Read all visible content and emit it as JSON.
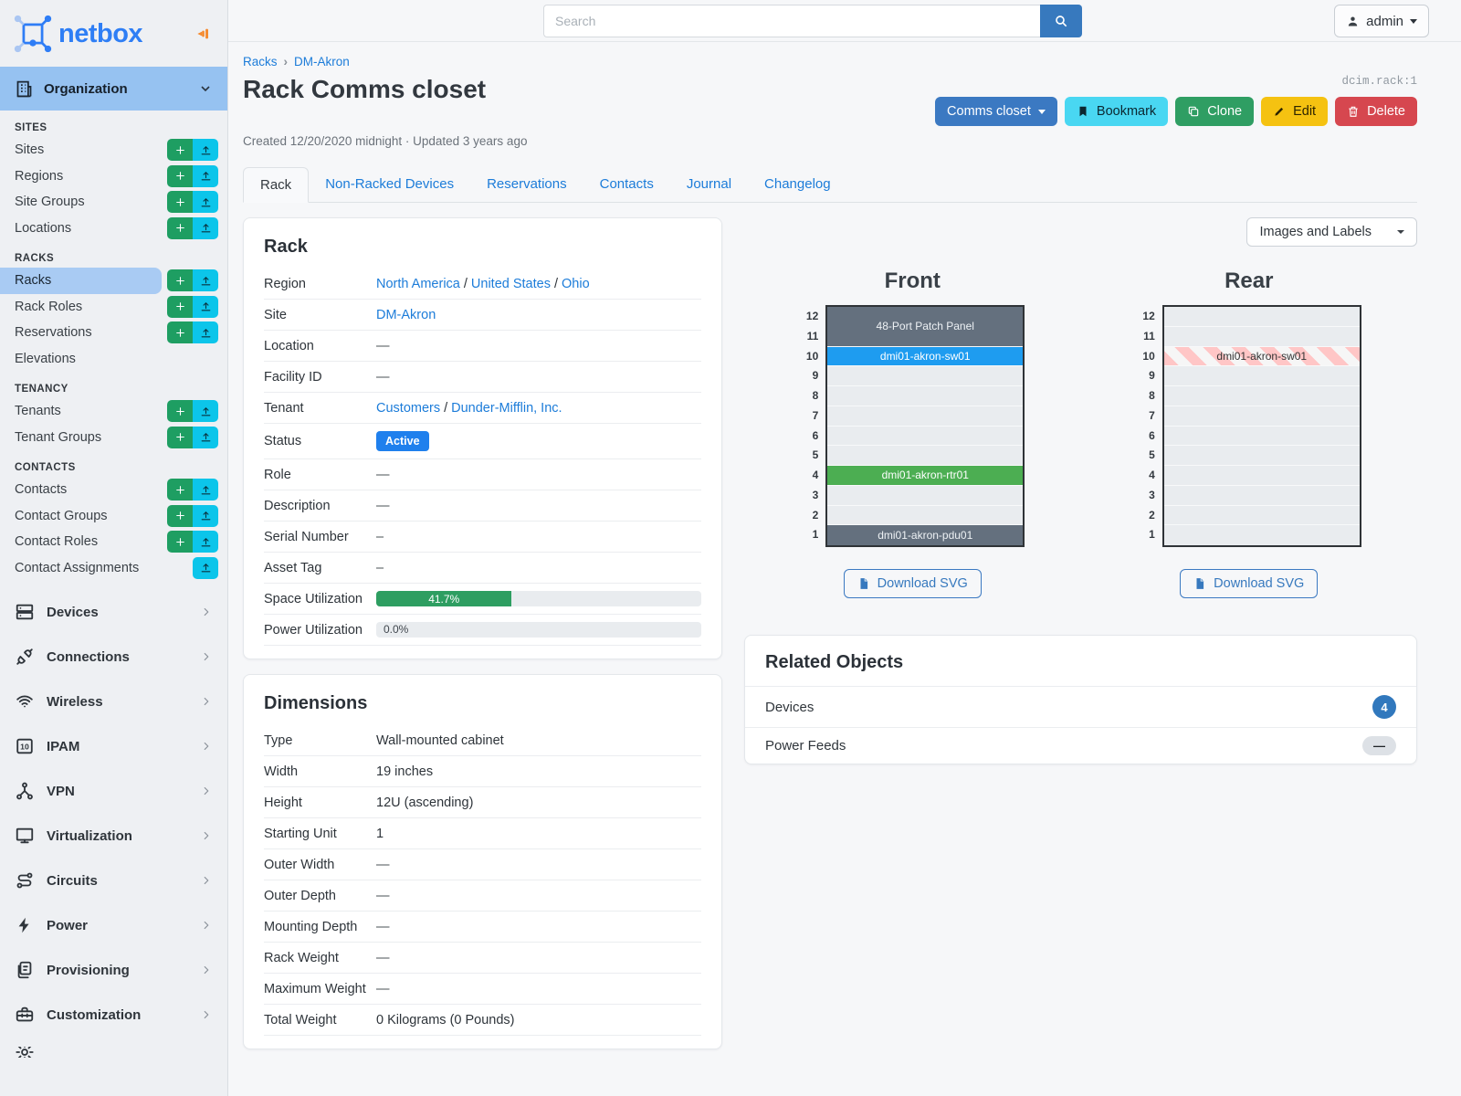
{
  "sidebar": {
    "logo_text": "netbox",
    "org_label": "Organization",
    "sections": [
      {
        "header": "SITES",
        "items": [
          {
            "label": "Sites",
            "add": true,
            "import": true
          },
          {
            "label": "Regions",
            "add": true,
            "import": true
          },
          {
            "label": "Site Groups",
            "add": true,
            "import": true
          },
          {
            "label": "Locations",
            "add": true,
            "import": true
          }
        ]
      },
      {
        "header": "RACKS",
        "items": [
          {
            "label": "Racks",
            "add": true,
            "import": true,
            "active": true
          },
          {
            "label": "Rack Roles",
            "add": true,
            "import": true
          },
          {
            "label": "Reservations",
            "add": true,
            "import": true
          },
          {
            "label": "Elevations"
          }
        ]
      },
      {
        "header": "TENANCY",
        "items": [
          {
            "label": "Tenants",
            "add": true,
            "import": true
          },
          {
            "label": "Tenant Groups",
            "add": true,
            "import": true
          }
        ]
      },
      {
        "header": "CONTACTS",
        "items": [
          {
            "label": "Contacts",
            "add": true,
            "import": true
          },
          {
            "label": "Contact Groups",
            "add": true,
            "import": true
          },
          {
            "label": "Contact Roles",
            "add": true,
            "import": true
          },
          {
            "label": "Contact Assignments",
            "import": true
          }
        ]
      }
    ],
    "menus": [
      {
        "label": "Devices",
        "icon": "server"
      },
      {
        "label": "Connections",
        "icon": "plug"
      },
      {
        "label": "Wireless",
        "icon": "wifi"
      },
      {
        "label": "IPAM",
        "icon": "binary"
      },
      {
        "label": "VPN",
        "icon": "network"
      },
      {
        "label": "Virtualization",
        "icon": "monitor"
      },
      {
        "label": "Circuits",
        "icon": "route"
      },
      {
        "label": "Power",
        "icon": "bolt"
      },
      {
        "label": "Provisioning",
        "icon": "files"
      },
      {
        "label": "Customization",
        "icon": "toolbox"
      },
      {
        "label": "",
        "icon": "gear",
        "partial": true
      }
    ]
  },
  "header": {
    "search_placeholder": "Search",
    "user": "admin"
  },
  "page": {
    "breadcrumb": [
      "Racks",
      "DM-Akron"
    ],
    "title": "Rack Comms closet",
    "meta": "Created 12/20/2020 midnight · Updated 3 years ago",
    "object_id": "dcim.rack:1",
    "actions": {
      "context": "Comms closet",
      "bookmark": "Bookmark",
      "clone": "Clone",
      "edit": "Edit",
      "delete": "Delete"
    },
    "tabs": [
      {
        "label": "Rack",
        "active": true
      },
      {
        "label": "Non-Racked Devices"
      },
      {
        "label": "Reservations"
      },
      {
        "label": "Contacts"
      },
      {
        "label": "Journal"
      },
      {
        "label": "Changelog"
      }
    ]
  },
  "rack_panel": {
    "title": "Rack",
    "rows": [
      {
        "label": "Region",
        "type": "links",
        "parts": [
          "North America",
          "United States",
          "Ohio"
        ]
      },
      {
        "label": "Site",
        "type": "links",
        "parts": [
          "DM-Akron"
        ]
      },
      {
        "label": "Location",
        "type": "dash",
        "value": "—"
      },
      {
        "label": "Facility ID",
        "type": "dash",
        "value": "—"
      },
      {
        "label": "Tenant",
        "type": "links",
        "parts": [
          "Customers",
          "Dunder-Mifflin, Inc."
        ]
      },
      {
        "label": "Status",
        "type": "badge",
        "value": "Active"
      },
      {
        "label": "Role",
        "type": "dash",
        "value": "—"
      },
      {
        "label": "Description",
        "type": "dash",
        "value": "—"
      },
      {
        "label": "Serial Number",
        "type": "dash",
        "value": "–"
      },
      {
        "label": "Asset Tag",
        "type": "dash",
        "value": "–"
      },
      {
        "label": "Space Utilization",
        "type": "progress",
        "percent": 41.7,
        "text": "41.7%"
      },
      {
        "label": "Power Utilization",
        "type": "progress",
        "percent": 0,
        "text": "0.0%"
      }
    ]
  },
  "dimensions_panel": {
    "title": "Dimensions",
    "rows": [
      {
        "label": "Type",
        "value": "Wall-mounted cabinet"
      },
      {
        "label": "Width",
        "value": "19 inches"
      },
      {
        "label": "Height",
        "value": "12U (ascending)"
      },
      {
        "label": "Starting Unit",
        "value": "1"
      },
      {
        "label": "Outer Width",
        "value": "—"
      },
      {
        "label": "Outer Depth",
        "value": "—"
      },
      {
        "label": "Mounting Depth",
        "value": "—"
      },
      {
        "label": "Rack Weight",
        "value": "—"
      },
      {
        "label": "Maximum Weight",
        "value": "—"
      },
      {
        "label": "Total Weight",
        "value": "0 Kilograms (0 Pounds)"
      }
    ]
  },
  "elevations": {
    "view_mode": "Images and Labels",
    "units": 12,
    "front": {
      "title": "Front",
      "download_label": "Download SVG",
      "devices": [
        {
          "name": "48-Port Patch Panel",
          "top_unit": 12,
          "span": 2,
          "color": "slate"
        },
        {
          "name": "dmi01-akron-sw01",
          "top_unit": 10,
          "span": 1,
          "color": "blue"
        },
        {
          "name": "dmi01-akron-rtr01",
          "top_unit": 4,
          "span": 1,
          "color": "green"
        },
        {
          "name": "dmi01-akron-pdu01",
          "top_unit": 1,
          "span": 1,
          "color": "slate"
        }
      ]
    },
    "rear": {
      "title": "Rear",
      "download_label": "Download SVG",
      "devices": [
        {
          "name": "dmi01-akron-sw01",
          "top_unit": 10,
          "span": 1,
          "color": "striped"
        }
      ]
    }
  },
  "related": {
    "title": "Related Objects",
    "rows": [
      {
        "label": "Devices",
        "badge": "4",
        "badge_style": "blue"
      },
      {
        "label": "Power Feeds",
        "badge": "—",
        "badge_style": "gray"
      }
    ]
  },
  "colors": {
    "brand_blue": "#2e7ef5",
    "link_blue": "#1c7cd9",
    "add_green": "#1e9e62",
    "import_cyan": "#0cc5ea",
    "primary_button": "#3b79c2",
    "bookmark_cyan": "#49d7f2",
    "clone_green": "#2f9e63",
    "edit_yellow": "#f5c211",
    "delete_red": "#d6474f",
    "status_active": "#1f80ed",
    "utilization_green": "#2e9e61",
    "device_slate": "#64707e",
    "device_blue": "#1e9cf0",
    "device_green": "#4cae52",
    "stripe_pink": "#ffc6c6"
  }
}
